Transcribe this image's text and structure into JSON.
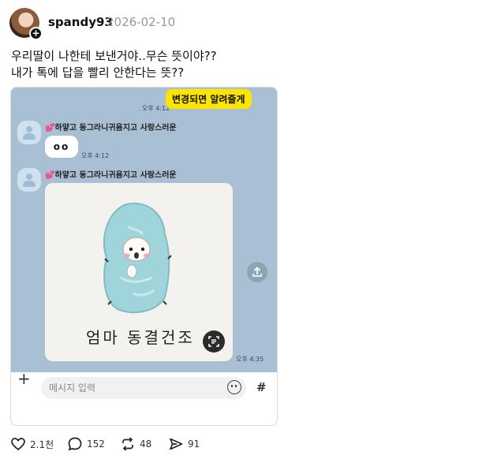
{
  "header": {
    "username": "spandy93",
    "date": "2026-02-10",
    "follow_glyph": "+"
  },
  "post": {
    "lines": [
      "우리딸이 나한테 보낸거야..무슨 뜻이야??",
      "내가 톡에 답을 빨리 안한다는 뜻??"
    ]
  },
  "chat": {
    "notice": "변경되면 알려줄게",
    "notice_time": "오후 4:12",
    "sender_name": "하얗고 동그라니귀욤지고 사랑스러운",
    "heart_glyph": "💕",
    "message1": "oo",
    "message1_time": "오후 4:12",
    "photo_caption": "엄마 동결건조",
    "photo_time": "오후 4:35",
    "input_placeholder": "메시지 입력",
    "plus_glyph": "+",
    "hash_glyph": "#",
    "colors": {
      "background": "#a9bfd3",
      "notice_bubble": "#fee500",
      "sender_heart": "#e8559b"
    }
  },
  "actions": {
    "likes": "2.1천",
    "comments": "152",
    "reposts": "48",
    "shares": "91"
  }
}
